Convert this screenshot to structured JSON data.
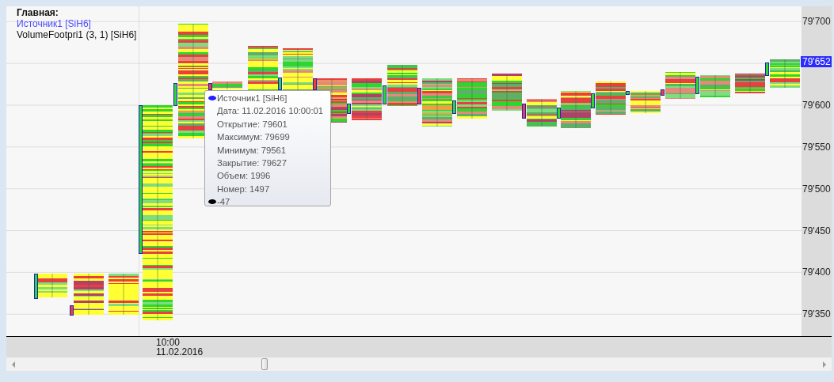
{
  "legend": {
    "title": "Главная:",
    "source": "Источник1 [SiH6]",
    "indicator": "VolumeFootpri1 (3, 1) [SiH6]"
  },
  "price_axis": {
    "labels": [
      "79'700",
      "79'600",
      "79'550",
      "79'500",
      "79'450",
      "79'400",
      "79'350"
    ],
    "current_price": "79'652"
  },
  "time_axis": {
    "time": "10:00",
    "date": "11.02.2016"
  },
  "tooltip": {
    "source": "Источник1 [SiH6]",
    "lines": [
      "Дата: 11.02.2016 10:00:01",
      "Открытие: 79601",
      "Максимум: 79699",
      "Минимум: 79561",
      "Закрытие: 79627",
      "Объем: 1996",
      "Номер: 1497"
    ],
    "delta": "-47"
  }
}
